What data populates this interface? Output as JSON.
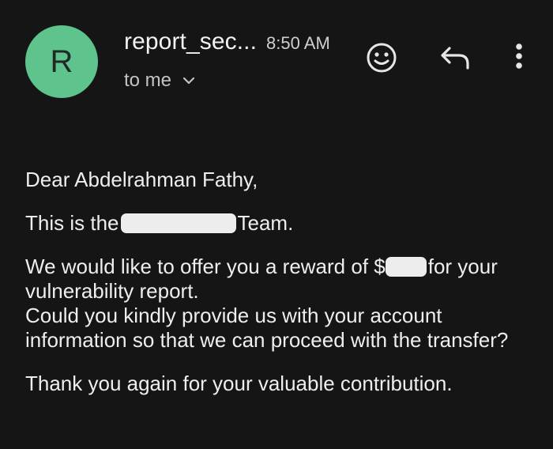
{
  "header": {
    "avatar_letter": "R",
    "sender": "report_sec...",
    "time": "8:50 AM",
    "recipient": "to me",
    "icons": {
      "emoji": "emoji-smile-icon",
      "reply": "reply-icon",
      "more": "more-vert-icon",
      "expand": "chevron-down-icon"
    },
    "avatar_color": "#5ec38d"
  },
  "email": {
    "greeting": "Dear Abdelrahman Fathy,",
    "team_prefix": "This is the",
    "team_suffix": "Team.",
    "offer_prefix": "We would like to offer you a reward of $",
    "offer_suffix": "for your vulnerability report.",
    "request": "Could you kindly provide us with your account information so that we can proceed with the transfer?",
    "thanks": "Thank you again for your valuable contribution."
  }
}
